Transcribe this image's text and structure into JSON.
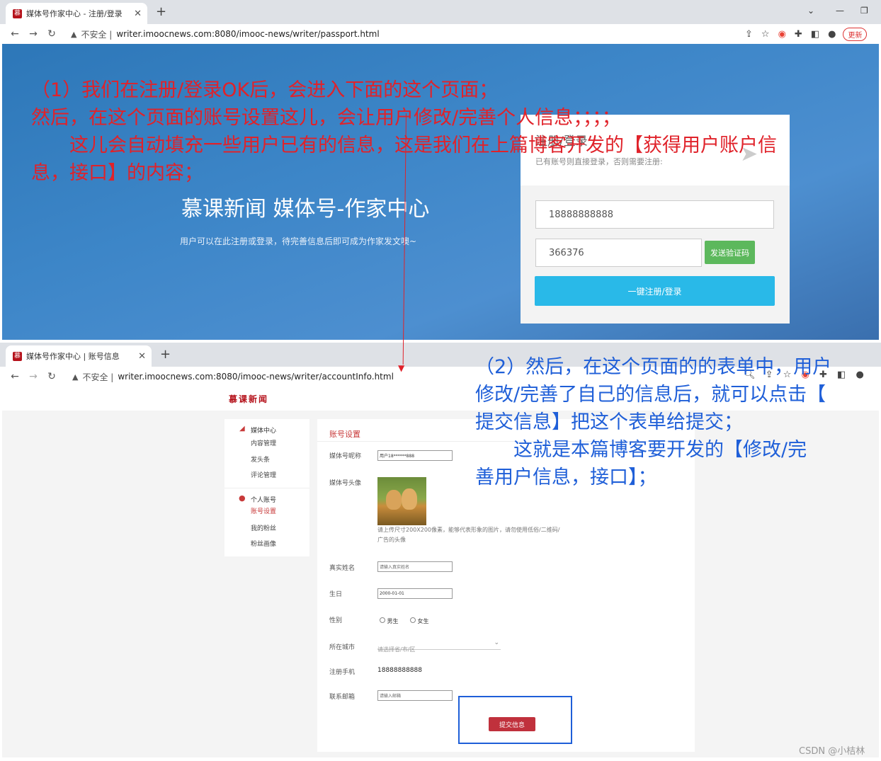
{
  "browser1": {
    "tab_title": "媒体号作家中心 - 注册/登录",
    "favicon": "慕",
    "insecure_label": "不安全 |",
    "url": "writer.imoocnews.com:8080/imooc-news/writer/passport.html",
    "update_label": "更新"
  },
  "hero": {
    "title": "慕课新闻 媒体号-作家中心",
    "subtitle": "用户可以在此注册或登录，待完善信息后即可成为作家发文噢~"
  },
  "login": {
    "heading": "注册/登录",
    "desc": "已有账号则直接登录，否则需要注册:",
    "phone_value": "18888888888",
    "code_value": "366376",
    "send_code_label": "发送验证码",
    "submit_label": "一键注册/登录"
  },
  "annotations": {
    "red_lines": [
      "（1）我们在注册/登录OK后，会进入下面的这个页面；",
      "然后，在这个页面的账号设置这儿，会让用户修改/完善个人信息；；；；",
      "　　这儿会自动填充一些用户已有的信息，这是我们在上篇博客开发的【获得用户账户信",
      "息，接口】的内容；"
    ],
    "blue_lines": [
      "（2）然后，在这个页面的的表单中，用户",
      "修改/完善了自己的信息后，就可以点击【",
      "提交信息】把这个表单给提交；",
      "　　这就是本篇博客要开发的【修改/完",
      "善用户信息，接口】；"
    ]
  },
  "browser2": {
    "tab_title": "媒体号作家中心 | 账号信息",
    "favicon": "慕",
    "insecure_label": "不安全 |",
    "url": "writer.imoocnews.com:8080/imooc-news/writer/accountInfo.html"
  },
  "site": {
    "logo": "慕课新闻"
  },
  "sidebar": {
    "section1": "媒体中心",
    "items1": [
      "内容管理",
      "发头条",
      "评论管理"
    ],
    "section2": "个人账号",
    "items2": [
      "账号设置",
      "我的粉丝",
      "粉丝画像"
    ]
  },
  "form": {
    "title": "账号设置",
    "nickname_label": "媒体号昵称",
    "nickname_value": "用户18******888",
    "avatar_label": "媒体号头像",
    "avatar_hint": [
      "请上传尺寸200X200像素，能够代表形象的图片，请勿使用低俗/二维码/",
      "广告的头像"
    ],
    "realname_label": "真实姓名",
    "realname_placeholder": "请输入真实姓名",
    "birthday_label": "生日",
    "birthday_value": "2000-01-01",
    "gender_label": "性别",
    "gender_male": "男生",
    "gender_female": "女生",
    "city_label": "所在城市",
    "city_placeholder": "请选择省/市/区",
    "phone_label": "注册手机",
    "phone_value": "18888888888",
    "email_label": "联系邮箱",
    "email_placeholder": "请输入邮箱",
    "submit_label": "提交信息"
  },
  "watermark": "CSDN @小桔林",
  "colors": {
    "annotation_red": "#e0222a",
    "annotation_blue": "#1f5fd8",
    "brand_red": "#c0313c",
    "login_cyan": "#29b9e8",
    "code_green": "#5cb85c"
  }
}
